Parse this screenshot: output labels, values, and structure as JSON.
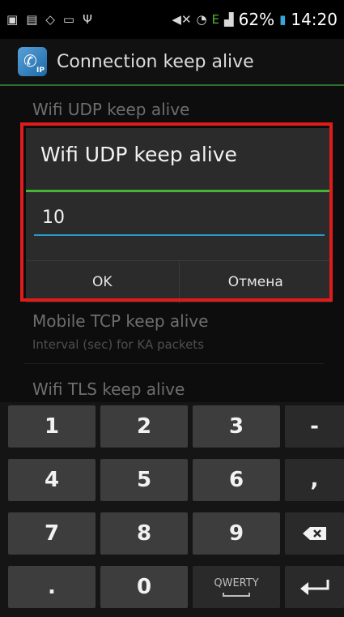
{
  "status_bar": {
    "battery_percent": "62%",
    "time": "14:20",
    "network": "E",
    "icons": [
      "notification-icon",
      "image-icon",
      "shield-icon",
      "keyboard-icon",
      "usb-icon",
      "mute-icon",
      "wifi-icon",
      "signal-icon",
      "battery-icon"
    ]
  },
  "action_bar": {
    "title": "Connection keep alive",
    "icon_badge": "IP"
  },
  "preferences": {
    "item1": {
      "title": "Wifi UDP keep alive"
    },
    "item2": {
      "title": "Mobile TCP keep alive",
      "summary": "Interval (sec) for KA packets"
    },
    "item3": {
      "title": "Wifi TLS keep alive"
    }
  },
  "dialog": {
    "title": "Wifi UDP keep alive",
    "input_value": "10",
    "ok_label": "OK",
    "cancel_label": "Отмена"
  },
  "keyboard": {
    "keys": {
      "k1": "1",
      "k2": "2",
      "k3": "3",
      "minus": "-",
      "k4": "4",
      "k5": "5",
      "k6": "6",
      "comma": ",",
      "k7": "7",
      "k8": "8",
      "k9": "9",
      "dot": ".",
      "k0": "0",
      "qwerty": "QWERTY"
    },
    "icons": {
      "backspace": "backspace-icon",
      "enter": "enter-icon"
    }
  },
  "colors": {
    "highlight": "#e01b1b",
    "accent_green": "#46b536",
    "input_underline": "#2a9acb"
  }
}
